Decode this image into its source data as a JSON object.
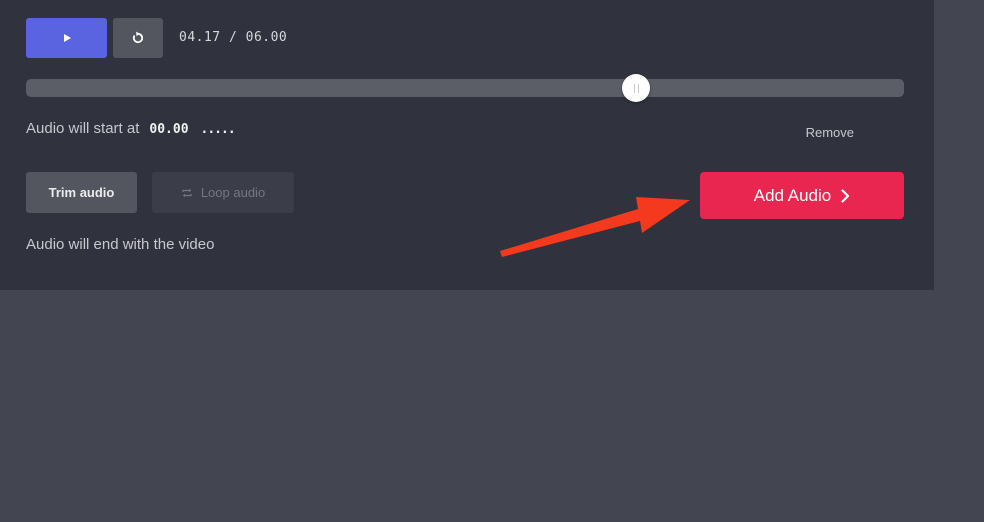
{
  "player": {
    "current_time": "04.17",
    "separator": " / ",
    "total_time": "06.00",
    "progress": 0.695
  },
  "audio": {
    "start_label": "Audio will start at",
    "start_time": "00.00",
    "start_placeholder": ".....",
    "remove_label": "Remove",
    "trim_label": "Trim audio",
    "loop_label": "Loop audio",
    "add_label": "Add Audio",
    "end_label": "Audio will end with the video"
  },
  "icons": {
    "play": "play-icon",
    "replay": "replay-icon",
    "loop": "loop-icon",
    "chevron": "chevron-right-icon",
    "annotation": "red-arrow-annotation"
  },
  "colors": {
    "panel": "#30323d",
    "background": "#434651",
    "play_button": "#5a63e0",
    "add_button": "#e8264f",
    "annotation_arrow": "#f4391f"
  }
}
